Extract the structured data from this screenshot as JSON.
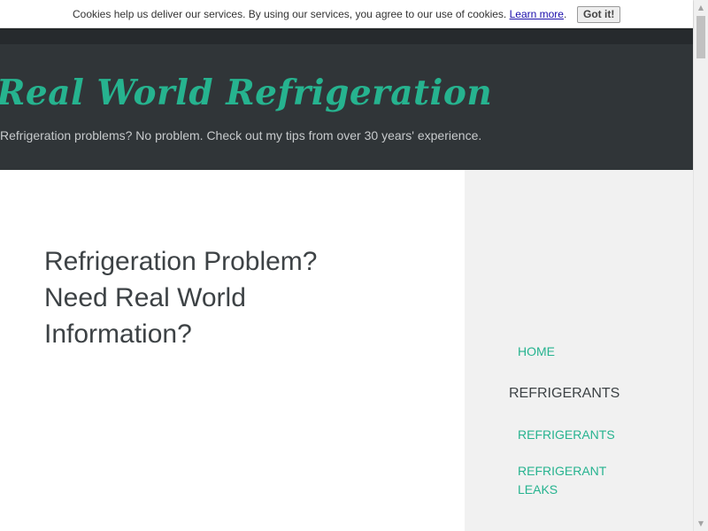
{
  "cookie_bar": {
    "message": "Cookies help us deliver our services. By using our services, you agree to our use of cookies.",
    "learn_more": "Learn more",
    "period": ".",
    "got_it": "Got it!"
  },
  "header": {
    "site_title": "Real World Refrigeration",
    "tagline": "Refrigeration problems? No problem. Check out my tips from over 30 years' experience."
  },
  "main": {
    "heading": "Refrigeration Problem? Need Real World Information?"
  },
  "sidebar": {
    "home": "HOME",
    "section_heading": "REFRIGERANTS",
    "link_refrigerants": "REFRIGERANTS",
    "link_refrigerant_leaks": "REFRIGERANT LEAKS"
  },
  "scrollbar": {
    "up_arrow": "▲",
    "down_arrow": "▼"
  },
  "colors": {
    "accent": "#26b38f",
    "header_bg": "#303538",
    "sidebar_bg": "#f1f1f1"
  }
}
